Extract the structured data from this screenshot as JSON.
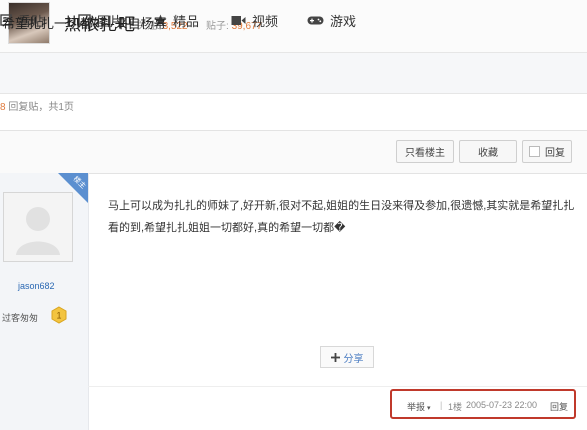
{
  "header": {
    "bar_name": "热依扎吧",
    "follow_label": "关注:",
    "follow_count": "3,522",
    "posts_label": "贴子:",
    "posts_count": "39,677"
  },
  "nav": {
    "items": [
      {
        "label": "看贴",
        "icon": "list-icon"
      },
      {
        "label": "图片",
        "icon": "image-icon"
      },
      {
        "label": "精品",
        "icon": "star-icon"
      },
      {
        "label": "视频",
        "icon": "video-icon"
      },
      {
        "label": "游戏",
        "icon": "gamepad-icon"
      }
    ]
  },
  "page_info": {
    "count": "8",
    "text": " 回复贴，共1页"
  },
  "thread": {
    "title": "希望扎扎一切都好--来自杨幂",
    "only_op_label": "只看楼主",
    "favorite_label": "收藏",
    "reply_label": "回复"
  },
  "post": {
    "badge": "楼主",
    "username": "jason682",
    "level_name": "过客匆匆",
    "level_num": "1",
    "content": "马上可以成为扎扎的师妹了,好开新,很对不起,姐姐的生日没来得及参加,很遗憾,其实就是希望扎扎看的到,希望扎扎姐姐一切都好,真的希望一切都�",
    "share_label": "分享",
    "report_label": "举报",
    "floor": "1楼",
    "datetime": "2005-07-23 22:00",
    "reply_label": "回复"
  },
  "colors": {
    "accent_orange": "#e07a3c",
    "link_blue": "#2a68b3",
    "highlight_red": "#c0392b",
    "badge_blue": "#5b8fd0"
  }
}
